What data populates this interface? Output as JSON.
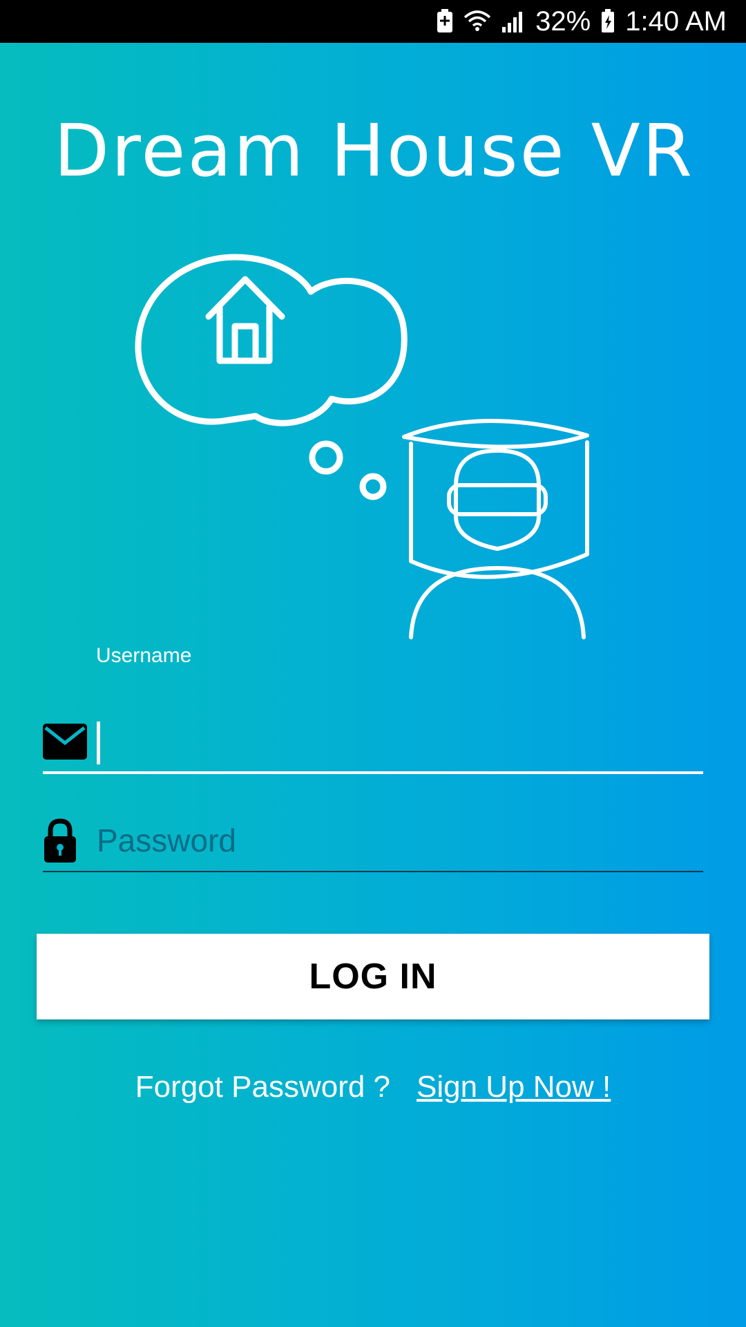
{
  "status_bar": {
    "battery_percent": "32%",
    "time": "1:40 AM",
    "icons": [
      "battery-saver-icon",
      "wifi-icon",
      "signal-icon",
      "battery-charging-icon"
    ]
  },
  "app": {
    "title": "Dream House VR",
    "illustration": "vr-dream-house-icon",
    "colors": {
      "gradient_start": "#06bcbe",
      "gradient_end": "#009be6"
    }
  },
  "form": {
    "username": {
      "label": "Username",
      "value": "",
      "icon": "envelope-icon"
    },
    "password": {
      "placeholder": "Password",
      "value": "",
      "icon": "lock-icon"
    },
    "login_label": "LOG IN"
  },
  "footer": {
    "forgot_password": "Forgot Password ?",
    "sign_up": "Sign Up Now !"
  }
}
